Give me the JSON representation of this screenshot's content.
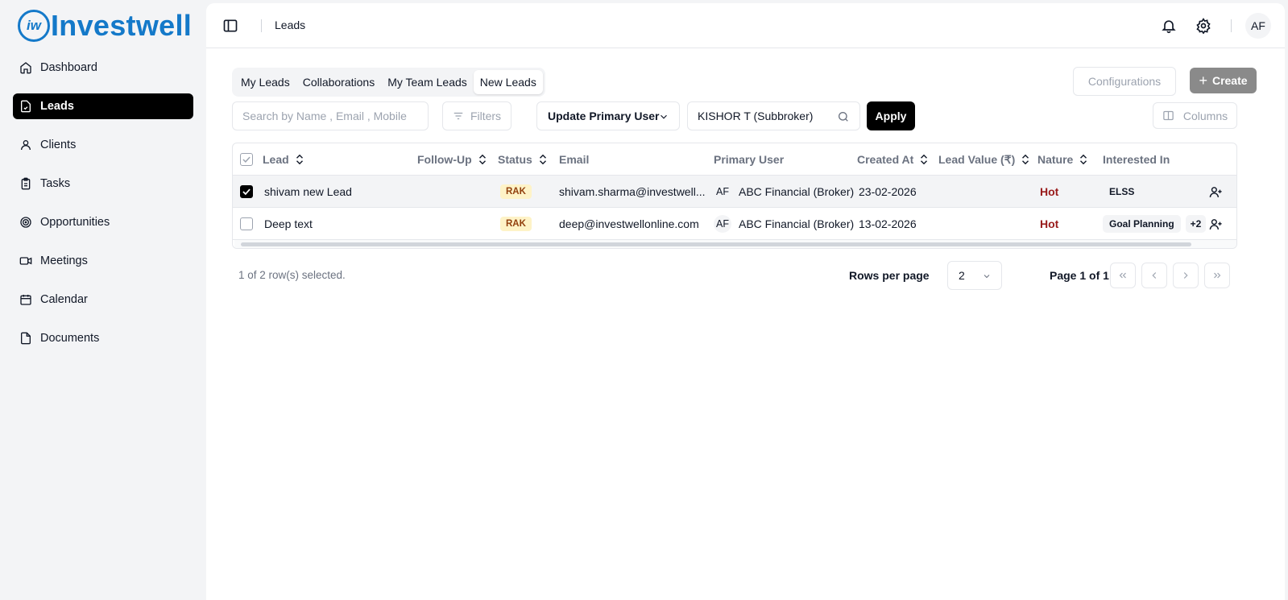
{
  "brand": {
    "badge": "iw",
    "name": "Investwell",
    "color": "#1479c9"
  },
  "sidebar": {
    "items": [
      {
        "label": "Dashboard",
        "icon": "home-icon"
      },
      {
        "label": "Leads",
        "icon": "file-check-icon",
        "active": true
      },
      {
        "label": "Clients",
        "icon": "user-icon"
      },
      {
        "label": "Tasks",
        "icon": "clipboard-icon"
      },
      {
        "label": "Opportunities",
        "icon": "target-icon"
      },
      {
        "label": "Meetings",
        "icon": "video-icon"
      },
      {
        "label": "Calendar",
        "icon": "calendar-icon"
      },
      {
        "label": "Documents",
        "icon": "file-icon"
      }
    ]
  },
  "topbar": {
    "title": "Leads",
    "avatar": "AF"
  },
  "tabs": [
    {
      "label": "My Leads"
    },
    {
      "label": "Collaborations"
    },
    {
      "label": "My Team Leads"
    },
    {
      "label": "New Leads",
      "active": true
    }
  ],
  "toolbar": {
    "configurations": "Configurations",
    "create": "Create",
    "search_placeholder": "Search by Name , Email , Mobile",
    "filters": "Filters",
    "update_primary_user": "Update Primary User",
    "selected_user": "KISHOR T (Subbroker)",
    "apply": "Apply",
    "columns": "Columns"
  },
  "table": {
    "headers": {
      "lead": "Lead",
      "follow_up": "Follow-Up",
      "status": "Status",
      "email": "Email",
      "primary_user": "Primary User",
      "created_at": "Created At",
      "lead_value": "Lead Value (₹)",
      "nature": "Nature",
      "interested_in": "Interested In"
    },
    "rows": [
      {
        "selected": true,
        "lead": "shivam new Lead",
        "status": "RAK",
        "email": "shivam.sharma@investwell...",
        "pu_initials": "AF",
        "primary_user": "ABC Financial (Broker)",
        "created_at": "23-02-2026",
        "nature": "Hot",
        "interested": "ELSS",
        "more": ""
      },
      {
        "selected": false,
        "lead": "Deep text",
        "status": "RAK",
        "email": "deep@investwellonline.com",
        "pu_initials": "AF",
        "primary_user": "ABC Financial (Broker)",
        "created_at": "13-02-2026",
        "nature": "Hot",
        "interested": "Goal Planning",
        "more": "+2"
      }
    ]
  },
  "footer": {
    "selection": "1 of 2 row(s) selected.",
    "rows_per_page_label": "Rows per page",
    "rows_per_page": "2",
    "page": "Page 1 of 1"
  }
}
